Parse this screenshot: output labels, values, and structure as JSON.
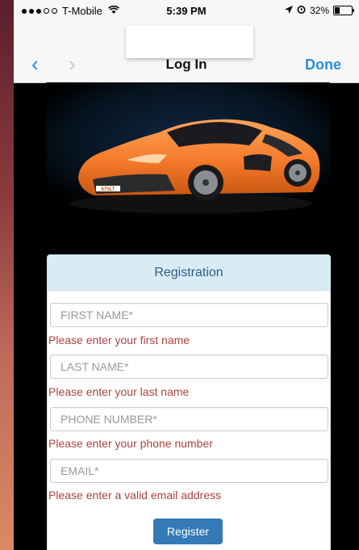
{
  "status_bar": {
    "carrier": "T-Mobile",
    "time": "5:39 PM",
    "battery": "32%",
    "battery_level": 0.32
  },
  "nav": {
    "title": "Log In",
    "done_label": "Done",
    "back_icon": "‹",
    "forward_icon": "›"
  },
  "hero": {
    "plate_text": "675LT"
  },
  "form": {
    "title": "Registration",
    "fields": [
      {
        "placeholder": "FIRST NAME*",
        "error": "Please enter your first name"
      },
      {
        "placeholder": "LAST NAME*",
        "error": "Please enter your last name"
      },
      {
        "placeholder": "PHONE NUMBER*",
        "error": "Please enter your phone number"
      },
      {
        "placeholder": "EMAIL*",
        "error": "Please enter a valid email address"
      }
    ],
    "submit_label": "Register"
  },
  "colors": {
    "accent": "#2a8ee0",
    "error": "#a94442",
    "button": "#337ab7",
    "car": "#f47a2a"
  }
}
